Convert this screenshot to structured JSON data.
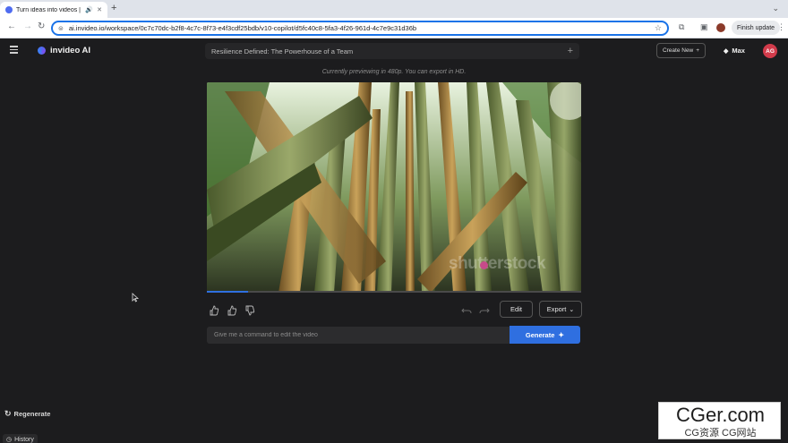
{
  "browser": {
    "tab_title": "Turn ideas into videos | AI",
    "new_tab": "+",
    "url": "ai.invideo.io/workspace/0c7c70dc-b2f8-4c7c-8f73-e4f3cdf25bdb/v10-copilot/d5fc40c8-5fa3-4f26-961d-4c7e9c31d36b",
    "finish_update_label": "Finish update"
  },
  "app": {
    "logo_text": "invideo AI",
    "project_title": "Resilience Defined: The Powerhouse of a Team",
    "create_new_label": "Create New",
    "plan_label": "Max",
    "avatar_initials": "AG",
    "preview_note": "Currently previewing in 480p. You can export in HD."
  },
  "video": {
    "watermark_text": "shutterstock",
    "progress_fraction": 0.11
  },
  "controls": {
    "edit_label": "Edit",
    "export_label": "Export"
  },
  "command": {
    "placeholder": "Give me a command to edit the video",
    "generate_label": "Generate"
  },
  "sidebar": {
    "regenerate_label": "Regenerate",
    "history_label": "History"
  },
  "overlay": {
    "site_main": "CGer.com",
    "site_sub": "CG资源 CG网站"
  },
  "colors": {
    "accent": "#2f6fe0",
    "background": "#1c1c1e",
    "avatar": "#d23b4b"
  }
}
